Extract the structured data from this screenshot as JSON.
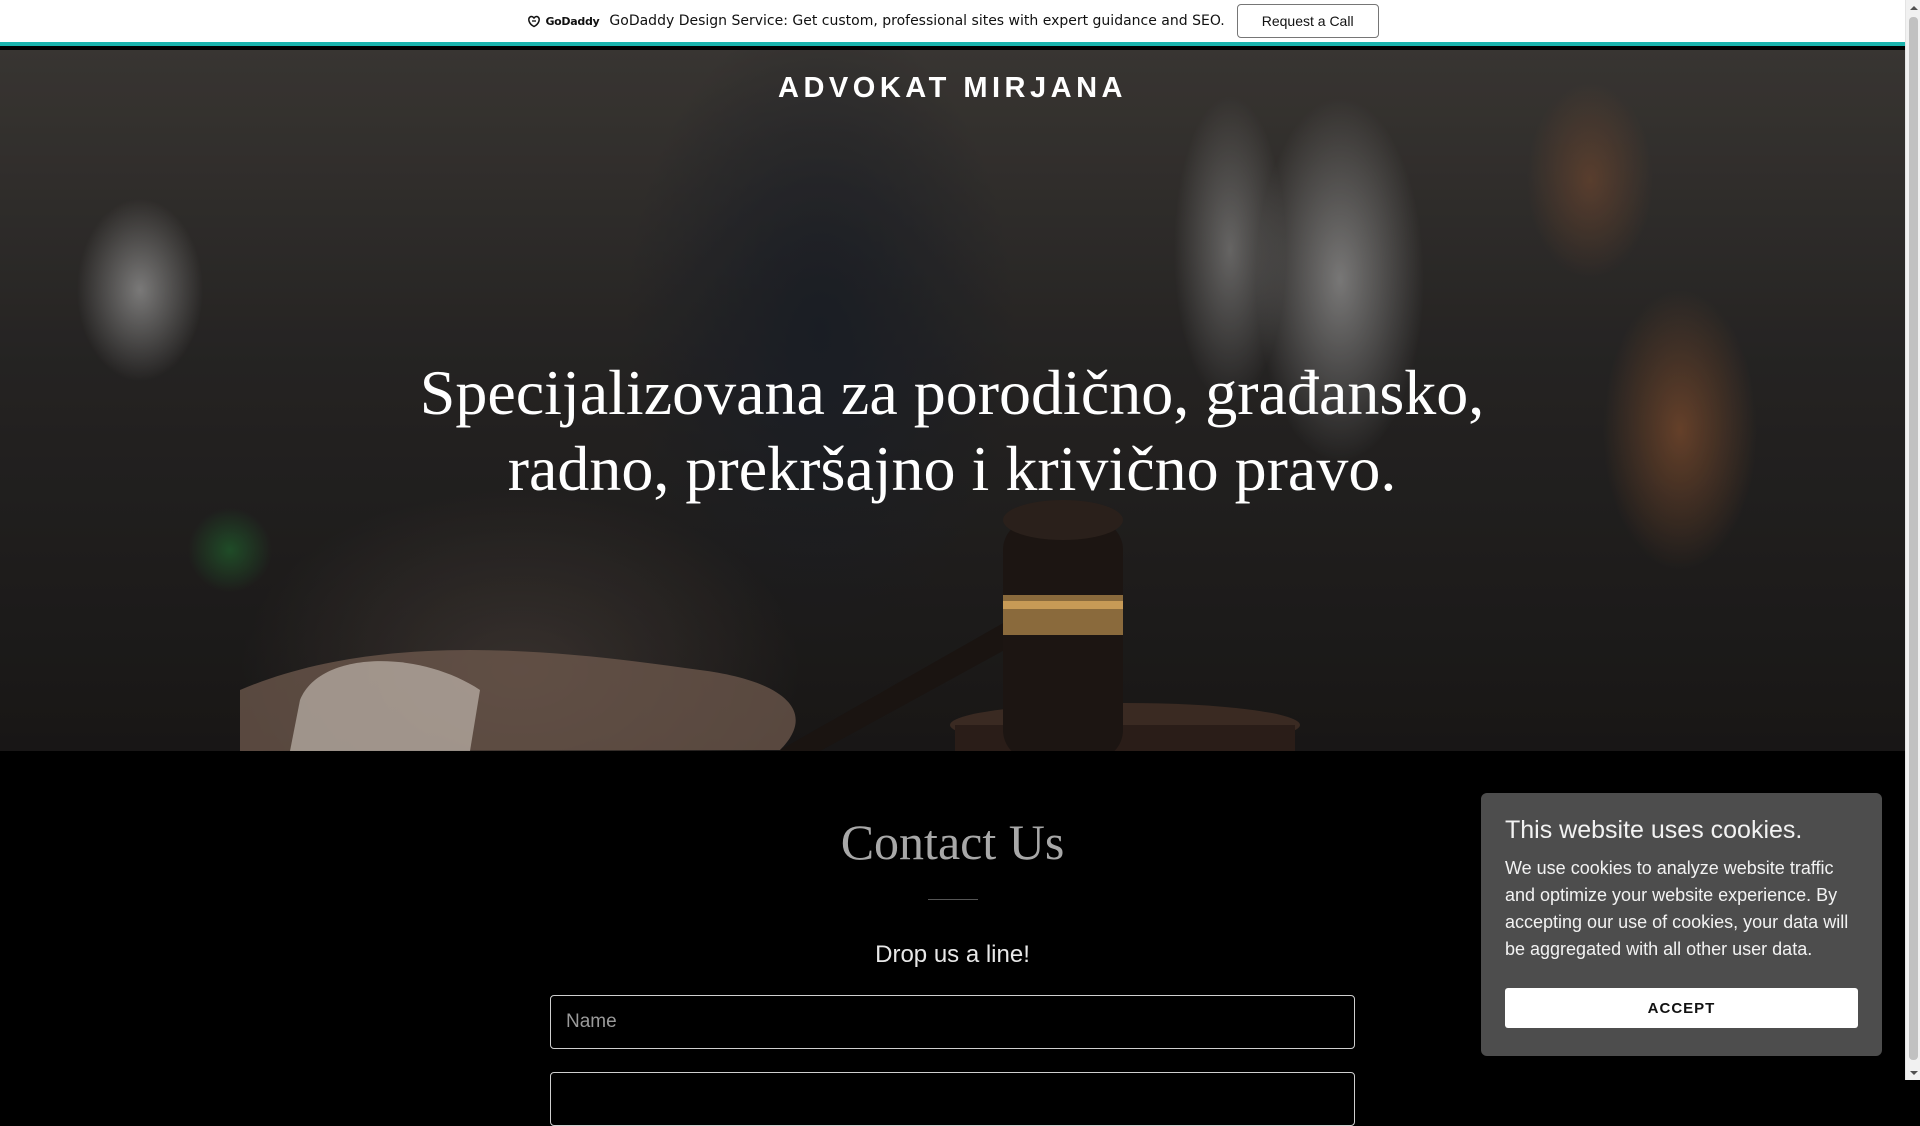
{
  "promo": {
    "logo_text": "GoDaddy",
    "message": "GoDaddy Design Service: Get custom, professional sites with expert guidance and SEO.",
    "button_label": "Request a Call",
    "accent_color": "#1bb3ad"
  },
  "hero": {
    "site_title": "ADVOKAT MIRJANA",
    "heading": "Specijalizovana za porodično, građansko, radno, prekršajno i krivično pravo."
  },
  "contact": {
    "title": "Contact Us",
    "subtitle": "Drop us a line!",
    "name_placeholder": "Name",
    "email_placeholder": ""
  },
  "cookie": {
    "title": "This website uses cookies.",
    "text": "We use cookies to analyze website traffic and optimize your website experience. By accepting our use of cookies, your data will be aggregated with all other user data.",
    "accept_label": "ACCEPT"
  },
  "icons": {
    "godaddy_logo": "godaddy-logo-icon",
    "scroll_up": "chevron-up-icon",
    "scroll_down": "chevron-down-icon"
  }
}
